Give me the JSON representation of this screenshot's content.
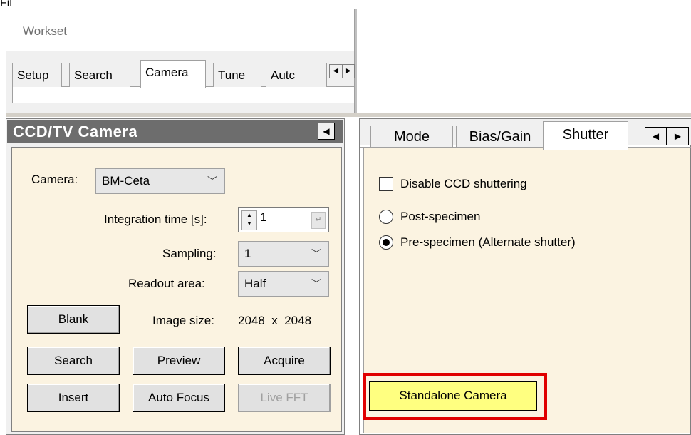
{
  "crop_label": "Fil",
  "workset": {
    "title": "Workset",
    "tabs": [
      "Setup",
      "Search",
      "Camera",
      "Tune",
      "Autc"
    ],
    "active_tab": "Camera"
  },
  "camera_panel": {
    "title": "CCD/TV Camera",
    "camera_label": "Camera:",
    "camera_value": "BM-Ceta",
    "integration_label": "Integration time [s]:",
    "integration_value": "1",
    "sampling_label": "Sampling:",
    "sampling_value": "1",
    "readout_label": "Readout area:",
    "readout_value": "Half",
    "image_size_label": "Image size:",
    "image_size_value": "2048  x  2048",
    "buttons": {
      "blank": "Blank",
      "search": "Search",
      "preview": "Preview",
      "acquire": "Acquire",
      "insert": "Insert",
      "auto_focus": "Auto Focus",
      "live_fft": "Live FFT"
    }
  },
  "right_panel": {
    "tabs": [
      "Mode",
      "Bias/Gain",
      "Shutter"
    ],
    "active_tab": "Shutter",
    "disable_shuttering_label": "Disable CCD shuttering",
    "disable_shuttering_checked": false,
    "post_specimen_label": "Post-specimen",
    "pre_specimen_label": "Pre-specimen (Alternate shutter)",
    "selected_shutter": "Pre-specimen (Alternate shutter)",
    "standalone_button": "Standalone Camera"
  },
  "colors": {
    "panel_header": "#6d6d6d",
    "panel_body": "#fbf3e1",
    "standalone_button_bg": "#ffff80",
    "highlight_border": "#e00000"
  }
}
